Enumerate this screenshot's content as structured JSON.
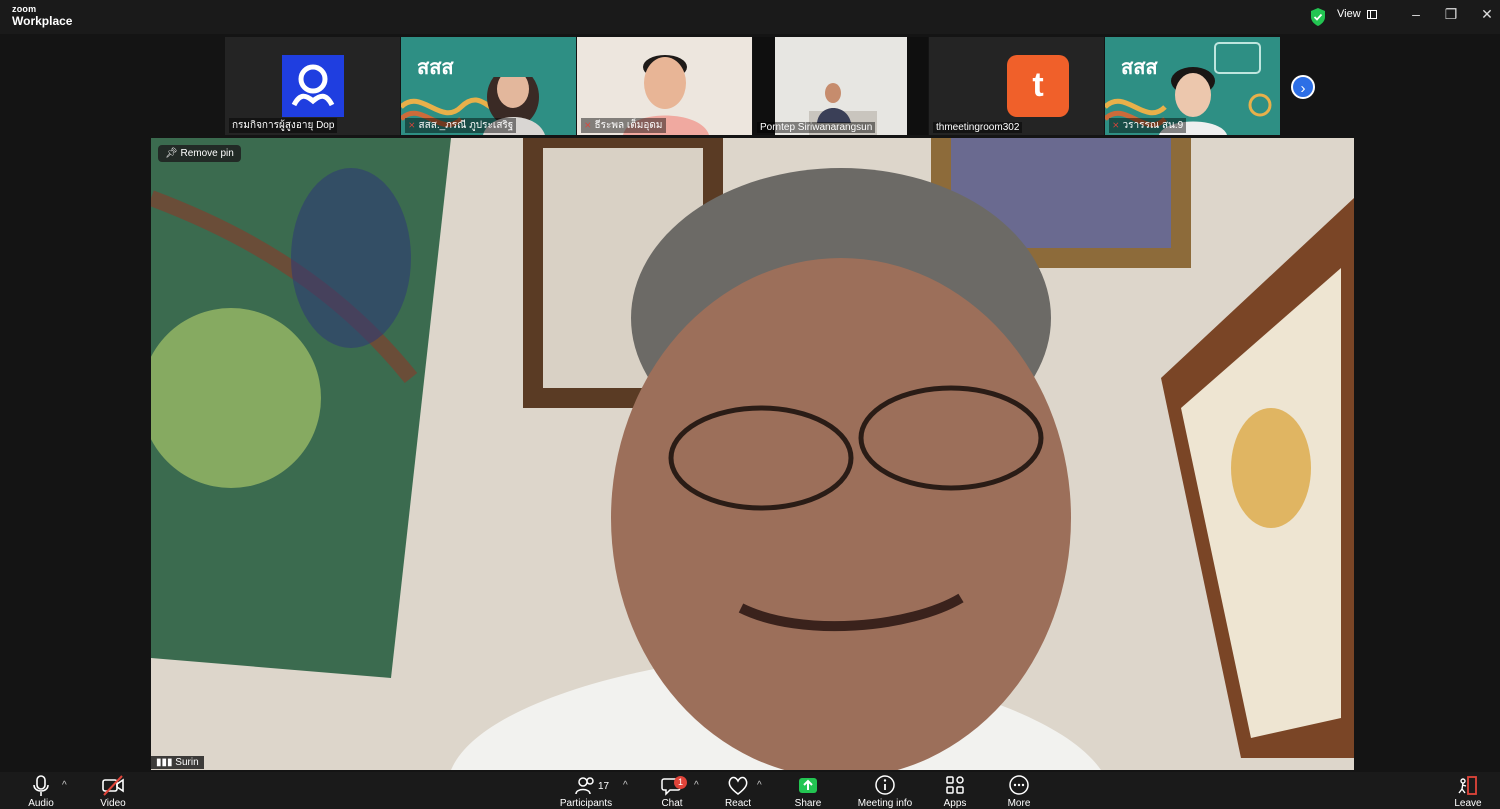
{
  "app": {
    "brand_small": "zoom",
    "brand_large": "Workplace"
  },
  "titlebar": {
    "view_label": "View",
    "minimize": "–",
    "restore": "❐",
    "close": "✕"
  },
  "participants_strip": [
    {
      "name": "กรมกิจการผู้สูงอายุ Dop",
      "muted": false,
      "type": "logo"
    },
    {
      "name": "สสส._ภรณี ภูประเสริฐ",
      "muted": true,
      "type": "video",
      "logo_text": "สสส"
    },
    {
      "name": "ธีระพล เต็มอุดม",
      "muted": true,
      "type": "video"
    },
    {
      "name": "Porntep Siriwanarangsun",
      "muted": false,
      "type": "video"
    },
    {
      "name": "thmeetingroom302",
      "muted": false,
      "type": "avatar",
      "avatar_letter": "t"
    },
    {
      "name": "วรารรณ สน.9",
      "muted": true,
      "type": "video",
      "logo_text": "สสส"
    }
  ],
  "main": {
    "remove_pin_label": "Remove pin",
    "speaker_name": "Surin"
  },
  "toolbar": {
    "audio": "Audio",
    "video": "Video",
    "participants": "Participants",
    "participants_count": "17",
    "chat": "Chat",
    "chat_badge": "1",
    "react": "React",
    "share": "Share",
    "meeting_info": "Meeting info",
    "apps": "Apps",
    "more": "More",
    "leave": "Leave"
  },
  "colors": {
    "share_green": "#23c552",
    "leave_red": "#e0443a",
    "brand_teal": "#2e8f84",
    "accent_blue": "#2d6fe6"
  }
}
